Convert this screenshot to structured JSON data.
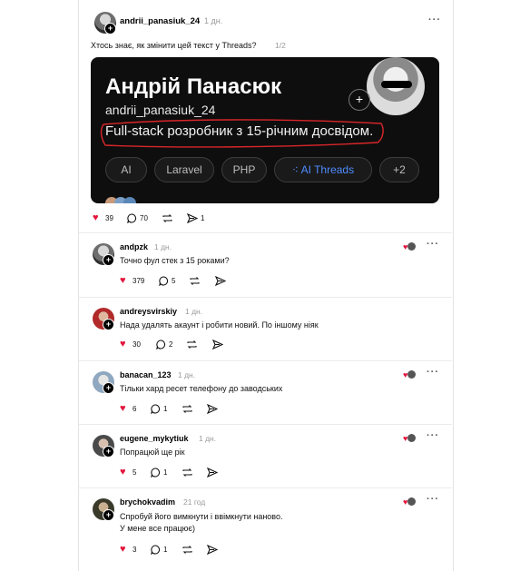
{
  "post": {
    "username": "andrii_panasiuk_24",
    "time": "1 дн.",
    "text": "Хтось знає, як змінити цей текст у Threads?",
    "page_indicator": "1/2",
    "likes": "39",
    "comments": "70",
    "shares": "1"
  },
  "card": {
    "name": "Андрій Панасюк",
    "handle": "andrii_panasiuk_24",
    "bio": "Full-stack розробник з 15-річним досвідом.",
    "tags": [
      "AI",
      "Laravel",
      "PHP",
      "AI Threads",
      "+2"
    ],
    "active_tag_color": "#4f8cff",
    "highlight_color": "#d9262a"
  },
  "replies": [
    {
      "username": "andpzk",
      "time": "1 дн.",
      "text": "Точно фул стек з 15 роками?",
      "likes": "379",
      "comments": "5"
    },
    {
      "username": "andreysvirskiy",
      "time": "1 дн.",
      "text": "Нада удалять акаунт і робити новий. По іншому ніяк",
      "likes": "30",
      "comments": "2"
    },
    {
      "username": "banacan_123",
      "time": "1 дн.",
      "text": "Тільки хард ресет телефону до заводських",
      "likes": "6",
      "comments": "1"
    },
    {
      "username": "eugene_mykytiuk",
      "time": "1 дн.",
      "text": "Попрацюй ще рік",
      "likes": "5",
      "comments": "1"
    },
    {
      "username": "brychokvadim",
      "time": "21 год",
      "text_line1": "Спробуй його вимкнути і ввімкнути наново.",
      "text_line2": "У мене все працює)",
      "likes": "3",
      "comments": "1"
    }
  ]
}
